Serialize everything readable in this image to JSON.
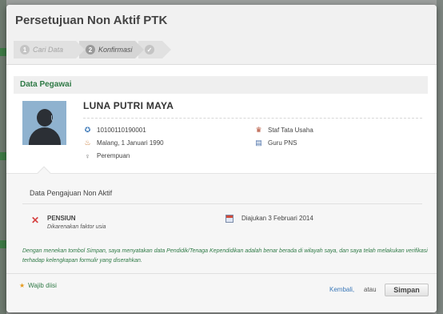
{
  "modal": {
    "title": "Persetujuan Non Aktif PTK"
  },
  "steps": [
    {
      "num": "1",
      "label": "Cari Data"
    },
    {
      "num": "2",
      "label": "Konfirmasi"
    },
    {
      "num": ""
    }
  ],
  "section": {
    "title": "Data Pegawai"
  },
  "employee": {
    "name": "LUNA PUTRI MAYA",
    "id_number": "10100110190001",
    "birth": "Malang, 1 Januari 1990",
    "gender": "Perempuan",
    "position": "Staf Tata Usaha",
    "status": "Guru PNS"
  },
  "submission": {
    "title": "Data Pengajuan Non Aktif",
    "type": "PENSIUN",
    "reason": "Dikarenakan faktor usia",
    "date": "Diajukan 3 Februari 2014"
  },
  "note": "Dengan menekan tombol Simpan, saya menyatakan data Pendidik/Tenaga Kependidikan adalah benar berada di wilayah saya, dan saya telah melakukan verifikasi terhadap kelengkapan formulir yang diserahkan.",
  "footer": {
    "required": "Wajib diisi",
    "back": "Kembali,",
    "or": "atau",
    "save": "Simpan"
  }
}
